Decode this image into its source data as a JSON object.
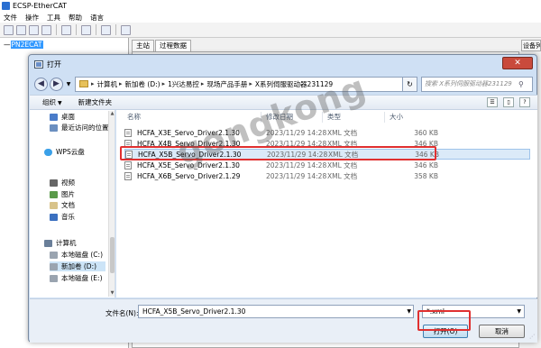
{
  "app": {
    "title": "ECSP-EtherCAT",
    "menu": [
      "文件",
      "操作",
      "工具",
      "帮助",
      "语言"
    ],
    "tree_root": "PN2ECAT",
    "tabs": [
      "主站",
      "过程数据"
    ],
    "right_tab": "设备列"
  },
  "dialog": {
    "title": "打开",
    "close_label": "✕",
    "breadcrumbs": [
      "计算机",
      "新加卷 (D:)",
      "1兴达易控",
      "现场产品手册",
      "X系列伺服驱动器231129"
    ],
    "search_placeholder": "搜索 X系列伺服驱动器231129",
    "commands": {
      "organize": "组织",
      "new_folder": "新建文件夹"
    },
    "nav_items": [
      {
        "label": "桌面",
        "icon": "desktop-icon"
      },
      {
        "label": "最近访问的位置",
        "icon": "recent-places-icon"
      },
      {
        "label": "WPS云盘",
        "icon": "cloud-icon"
      },
      {
        "label": "视频",
        "icon": "video-icon"
      },
      {
        "label": "图片",
        "icon": "picture-icon"
      },
      {
        "label": "文档",
        "icon": "document-icon"
      },
      {
        "label": "音乐",
        "icon": "music-icon"
      },
      {
        "label": "计算机",
        "icon": "computer-icon"
      },
      {
        "label": "本地磁盘 (C:)",
        "icon": "drive-icon"
      },
      {
        "label": "新加卷 (D:)",
        "icon": "drive-icon"
      },
      {
        "label": "本地磁盘 (E:)",
        "icon": "drive-icon"
      }
    ],
    "columns": {
      "name": "名称",
      "date": "修改日期",
      "type": "类型",
      "size": "大小"
    },
    "files": [
      {
        "name": "HCFA_X3E_Servo_Driver2.1.30",
        "date": "2023/11/29 14:28",
        "type": "XML 文档",
        "size": "360 KB"
      },
      {
        "name": "HCFA_X4B_Servo_Driver2.1.30",
        "date": "2023/11/29 14:28",
        "type": "XML 文档",
        "size": "346 KB"
      },
      {
        "name": "HCFA_X5B_Servo_Driver2.1.30",
        "date": "2023/11/29 14:28",
        "type": "XML 文档",
        "size": "346 KB"
      },
      {
        "name": "HCFA_X5E_Servo_Driver2.1.30",
        "date": "2023/11/29 14:28",
        "type": "XML 文档",
        "size": "346 KB"
      },
      {
        "name": "HCFA_X6B_Servo_Driver2.1.29",
        "date": "2023/11/29 14:28",
        "type": "XML 文档",
        "size": "358 KB"
      }
    ],
    "filename_label": "文件名(N):",
    "filename_value": "HCFA_X5B_Servo_Driver2.1.30",
    "filter_value": "*.xml",
    "open_label": "打开(O)",
    "cancel_label": "取消"
  },
  "watermark": "gongkong",
  "colors": {
    "highlight": "#e03030",
    "selection": "#dbeaf8",
    "dialog_bg": "#cfe0f4"
  }
}
